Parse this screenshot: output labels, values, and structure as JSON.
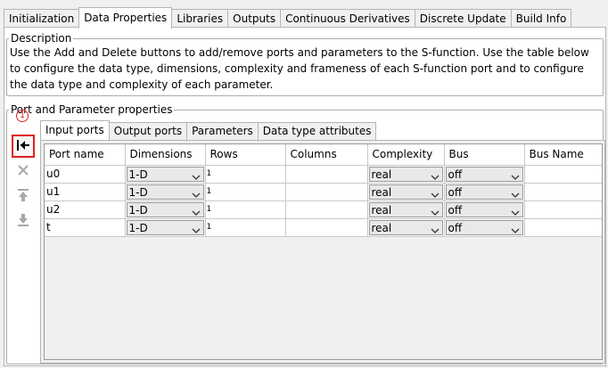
{
  "tabs": [
    {
      "label": "Initialization"
    },
    {
      "label": "Data Properties"
    },
    {
      "label": "Libraries"
    },
    {
      "label": "Outputs"
    },
    {
      "label": "Continuous Derivatives"
    },
    {
      "label": "Discrete Update"
    },
    {
      "label": "Build Info"
    }
  ],
  "active_tab": "Data Properties",
  "description": {
    "legend": "Description",
    "text": "Use the Add and Delete buttons to add/remove ports and parameters to the S-function. Use the table below to configure the data type, dimensions, complexity and frameness of each S-function port and to configure the data type and complexity of each parameter."
  },
  "ports_group": {
    "legend": "Port and Parameter properties",
    "annotation": "1"
  },
  "side_buttons": [
    {
      "icon": "add-port-icon"
    },
    {
      "icon": "delete-icon"
    },
    {
      "icon": "move-up-icon"
    },
    {
      "icon": "move-down-icon"
    }
  ],
  "subtabs": [
    {
      "label": "Input ports"
    },
    {
      "label": "Output ports"
    },
    {
      "label": "Parameters"
    },
    {
      "label": "Data type attributes"
    }
  ],
  "table": {
    "columns": [
      "Port name",
      "Dimensions",
      "Rows",
      "Columns",
      "Complexity",
      "Bus",
      "Bus Name"
    ],
    "rows": [
      {
        "name": "u0",
        "dimensions": "1-D",
        "rows": "1",
        "columns": "",
        "complexity": "real",
        "bus": "off"
      },
      {
        "name": "u1",
        "dimensions": "1-D",
        "rows": "1",
        "columns": "",
        "complexity": "real",
        "bus": "off"
      },
      {
        "name": "u2",
        "dimensions": "1-D",
        "rows": "1",
        "columns": "",
        "complexity": "real",
        "bus": "off"
      },
      {
        "name": "t",
        "dimensions": "1-D",
        "rows": "1",
        "columns": "",
        "complexity": "real",
        "bus": "off"
      }
    ]
  },
  "colors": {
    "highlight": "#e02020",
    "disabled_cell": "#c0c0c0",
    "panel_bg": "#f0f0f0"
  }
}
